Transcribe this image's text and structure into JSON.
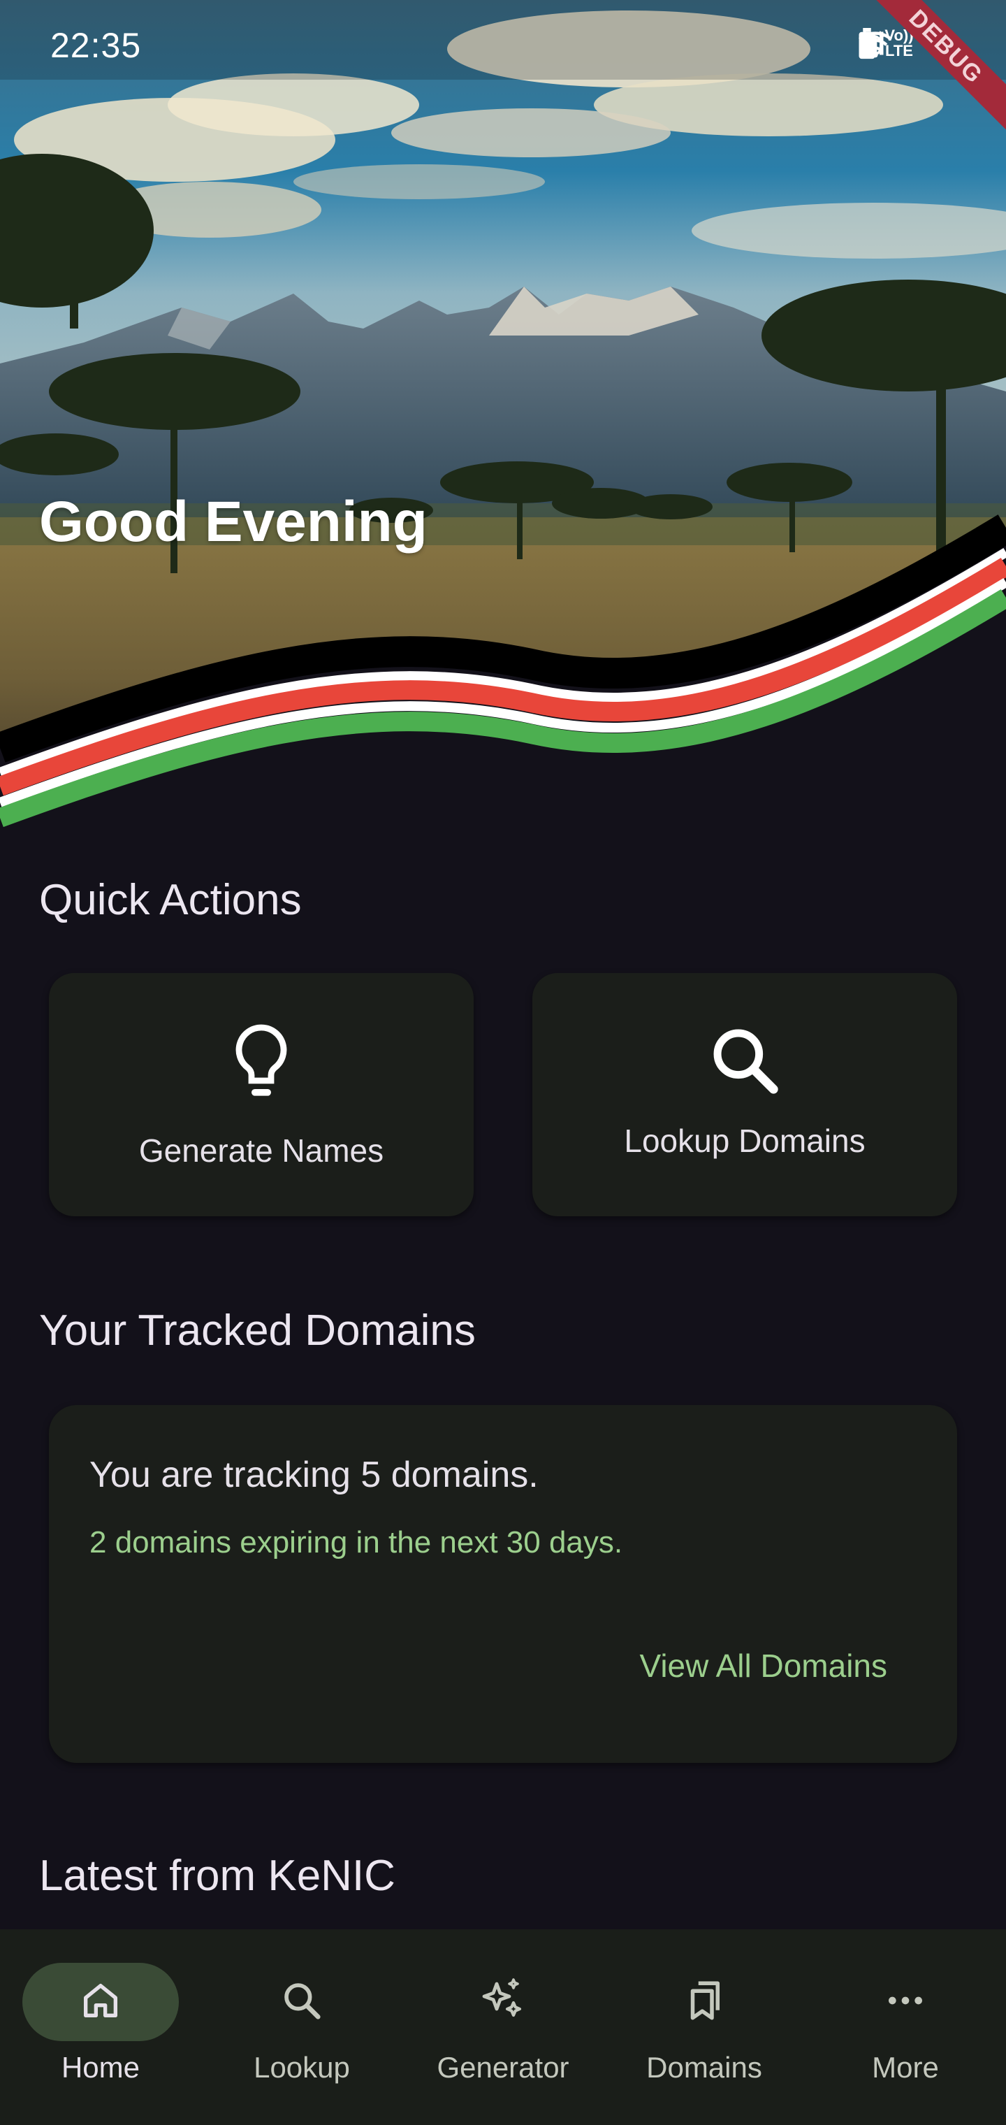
{
  "status_bar": {
    "time": "22:35",
    "icons": [
      "alarm-icon",
      "wifi-icon",
      "volte-icon",
      "signal-icon",
      "battery-icon"
    ],
    "volte_text": "Vo)) LTE",
    "debug_banner": "DEBUG"
  },
  "hero": {
    "greeting": "Good Evening",
    "flag_stripe_colors": [
      "#000000",
      "#ffffff",
      "#e8463a",
      "#ffffff",
      "#4caf50"
    ]
  },
  "quick_actions": {
    "title": "Quick Actions",
    "items": [
      {
        "label": "Generate Names",
        "icon": "lightbulb-icon"
      },
      {
        "label": "Lookup Domains",
        "icon": "search-icon"
      }
    ]
  },
  "tracked": {
    "title": "Your Tracked Domains",
    "summary": "You are tracking 5 domains.",
    "expiring": "2 domains expiring in the next 30 days.",
    "view_all": "View All Domains"
  },
  "latest": {
    "title": "Latest from KeNIC"
  },
  "bottom_nav": {
    "items": [
      {
        "label": "Home",
        "icon": "home-icon",
        "active": true
      },
      {
        "label": "Lookup",
        "icon": "search-icon",
        "active": false
      },
      {
        "label": "Generator",
        "icon": "sparkle-icon",
        "active": false
      },
      {
        "label": "Domains",
        "icon": "bookmarks-icon",
        "active": false
      },
      {
        "label": "More",
        "icon": "more-icon",
        "active": false
      }
    ]
  },
  "colors": {
    "background": "#13111a",
    "card": "#1b1e1a",
    "accent_green": "#9ccf8d",
    "nav_active_pill": "#3a4b36"
  }
}
